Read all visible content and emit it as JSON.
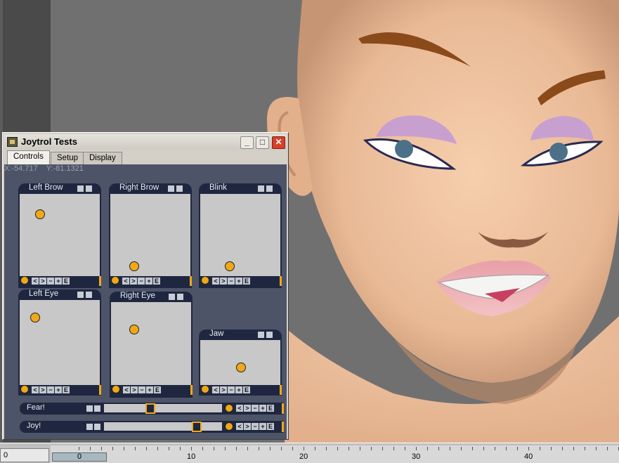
{
  "window": {
    "title": "Joytrol Tests",
    "buttons": {
      "minimize": "_",
      "maximize": "□",
      "close": "✕"
    }
  },
  "tabs": [
    "Controls",
    "Setup",
    "Display"
  ],
  "active_tab": "Controls",
  "coords": {
    "x": "X:-54.717",
    "y": "Y:-81.1321"
  },
  "joysticks": [
    {
      "label": "Left Brow"
    },
    {
      "label": "Right Brow"
    },
    {
      "label": "Blink"
    },
    {
      "label": "Left Eye"
    },
    {
      "label": "Right Eye"
    },
    {
      "label": "Jaw"
    }
  ],
  "footer_buttons": [
    "<",
    ">",
    "−",
    "+",
    "E"
  ],
  "sliders": [
    {
      "label": "Fear!",
      "value": 0.38
    },
    {
      "label": "Joy!",
      "value": 0.81
    }
  ],
  "timeline": {
    "current_frame": "0",
    "range_label": "0",
    "ticks": [
      "10",
      "20",
      "30",
      "40"
    ]
  },
  "colors": {
    "accent": "#f0a818",
    "panel": "#4d5468",
    "joy_bg": "#1f2740"
  },
  "icons": [
    "app-icon",
    "minimize-icon",
    "maximize-icon",
    "close-icon"
  ]
}
